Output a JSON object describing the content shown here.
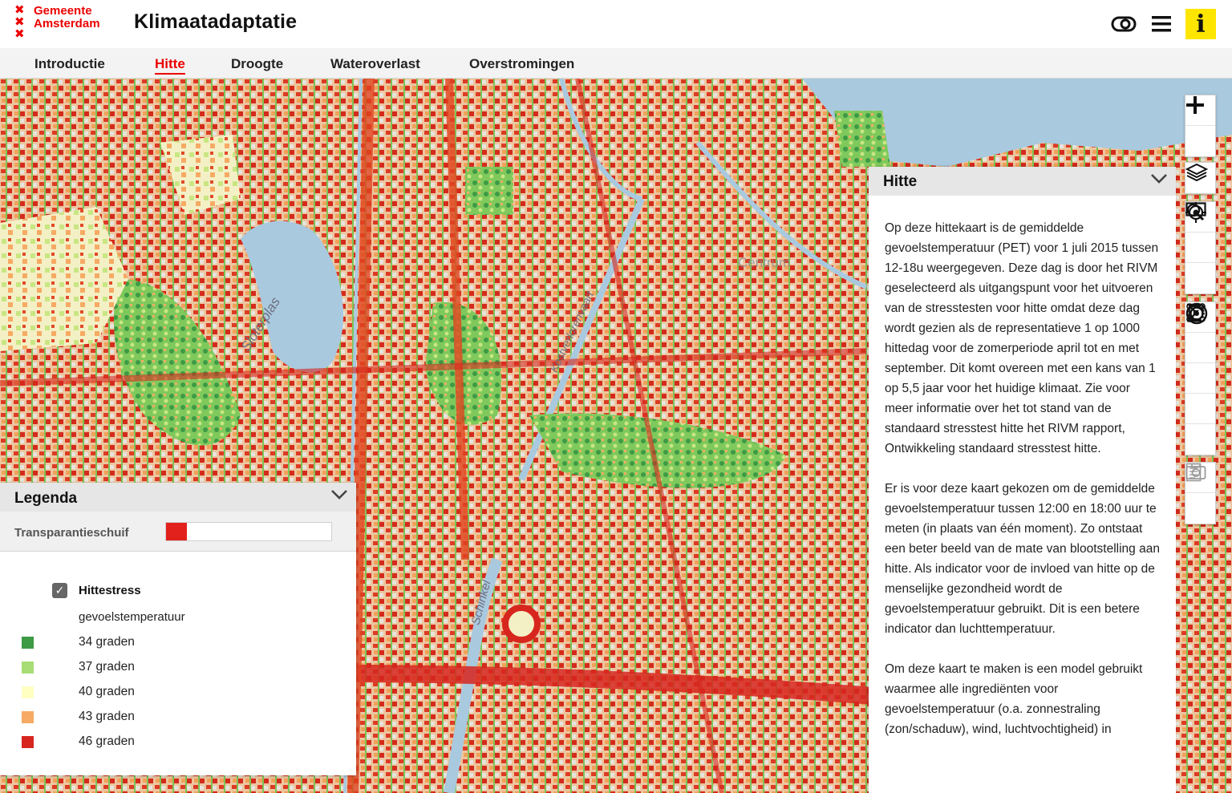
{
  "header": {
    "logo_line1": "Gemeente",
    "logo_line2": "Amsterdam",
    "app_title": "Klimaatadaptatie",
    "info_label": "i"
  },
  "tabs": [
    {
      "label": "Introductie",
      "active": false
    },
    {
      "label": "Hitte",
      "active": true
    },
    {
      "label": "Droogte",
      "active": false
    },
    {
      "label": "Wateroverlast",
      "active": false
    },
    {
      "label": "Overstromingen",
      "active": false
    }
  ],
  "map": {
    "labels": {
      "sloterplas": "Sloterplas",
      "centrum": "Centrum",
      "schinkel": "Schinkel",
      "kostverloren": "Kostverlorenvaart"
    }
  },
  "info_panel": {
    "title": "Hitte",
    "paragraphs": [
      "Op deze hittekaart is de gemiddelde gevoelstemperatuur (PET) voor 1 juli 2015 tussen 12-18u weergegeven. Deze dag is door het RIVM geselecteerd als uitgangspunt voor het uitvoeren van de stresstesten voor hitte omdat deze dag wordt gezien als de representatieve 1 op 1000 hittedag voor de zomerperiode april tot en met september. Dit komt overeen met een kans van 1 op 5,5 jaar voor het huidige klimaat. Zie voor meer informatie over het tot stand van de standaard stresstest hitte het RIVM rapport, Ontwikkeling standaard stresstest hitte.",
      "Er is voor deze kaart gekozen om de gemiddelde gevoelstemperatuur  tussen 12:00 en 18:00 uur te meten (in plaats van één moment). Zo ontstaat een beter beeld van de mate van blootstelling aan hitte. Als indicator voor de invloed van hitte op de menselijke gezondheid wordt de gevoelstemperatuur gebruikt. Dit is een betere indicator dan luchttemperatuur.",
      "Om deze kaart te maken is een model gebruikt waarmee alle ingrediënten voor gevoelstemperatuur (o.a. zonnestraling (zon/schaduw), wind, luchtvochtigheid) in"
    ]
  },
  "legend": {
    "title": "Legenda",
    "transparency_label": "Transparantieschuif",
    "transparency_value": 0.12,
    "layer_name": "Hittestress",
    "layer_checked": true,
    "sub_label": "gevoelstemperatuur",
    "items": [
      {
        "label": "34 graden",
        "color": "#3d9a45"
      },
      {
        "label": "37 graden",
        "color": "#a8dc74"
      },
      {
        "label": "40 graden",
        "color": "#ffffc2"
      },
      {
        "label": "43 graden",
        "color": "#f6aa64"
      },
      {
        "label": "46 graden",
        "color": "#d7261e"
      }
    ]
  },
  "colors": {
    "accent": "#ec0000",
    "water": "#a9c9df",
    "info_yellow": "#ffe600"
  },
  "icons": [
    "eye-icon",
    "menu-icon",
    "zoom-in-icon",
    "zoom-out-icon",
    "layers-icon",
    "rectangle-icon",
    "locate-icon",
    "search-icon",
    "measure-line-icon",
    "measure-area-icon",
    "radius-icon",
    "target-icon",
    "sum-icon",
    "camera-icon",
    "report-icon",
    "chevron-down-icon"
  ]
}
